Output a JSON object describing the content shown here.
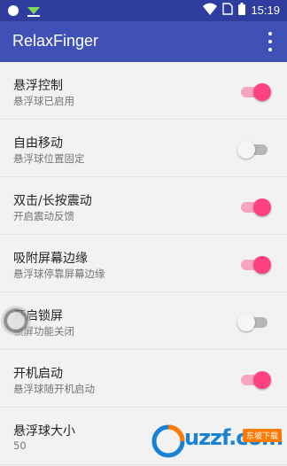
{
  "status_bar": {
    "time": "15:19",
    "icons": [
      "circle-icon",
      "download-icon",
      "wifi-icon",
      "sim-icon",
      "battery-icon"
    ]
  },
  "app_bar": {
    "title": "RelaxFinger",
    "menu_icon": "overflow-menu-icon"
  },
  "settings": [
    {
      "title": "悬浮控制",
      "summary": "悬浮球已启用",
      "enabled": true
    },
    {
      "title": "自由移动",
      "summary": "悬浮球位置固定",
      "enabled": false
    },
    {
      "title": "双击/长按震动",
      "summary": "开启震动反馈",
      "enabled": true
    },
    {
      "title": "吸附屏幕边缘",
      "summary": "悬浮球停靠屏幕边缘",
      "enabled": true
    },
    {
      "title": "开启锁屏",
      "summary": "锁屏功能关闭",
      "enabled": false
    },
    {
      "title": "开机启动",
      "summary": "悬浮球随开机启动",
      "enabled": true
    },
    {
      "title": "悬浮球大小",
      "summary": "50"
    }
  ],
  "watermark": {
    "text": "uzzf.com",
    "badge": "东坡下载"
  },
  "colors": {
    "status_bar": "#2f3e9e",
    "app_bar": "#3f51b5",
    "accent": "#ff4081",
    "background": "#f2f2f2"
  }
}
